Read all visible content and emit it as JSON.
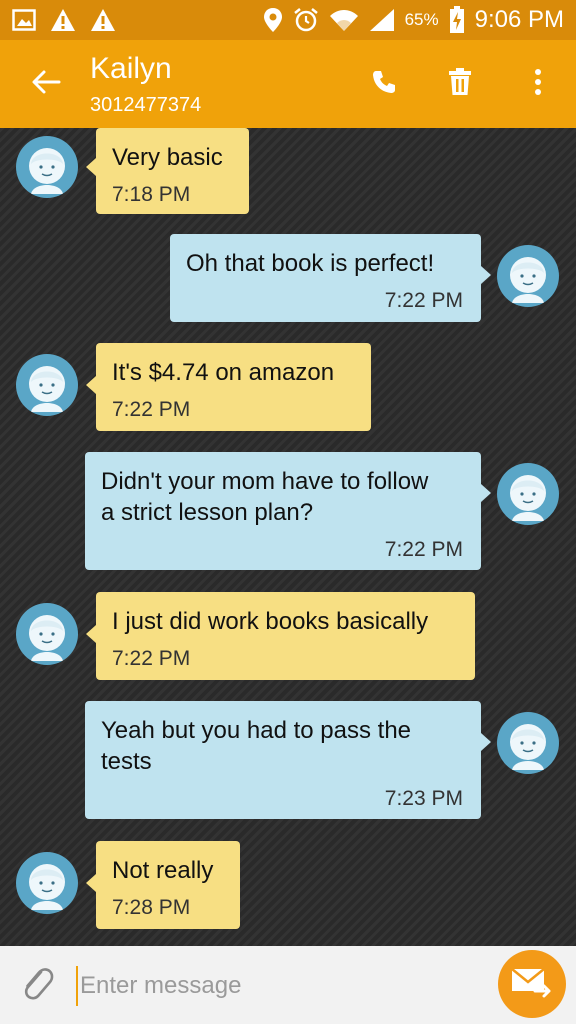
{
  "status_bar": {
    "battery_percent": "65%",
    "time": "9:06 PM",
    "icons": [
      "image-icon",
      "warning-icon",
      "warning-icon",
      "location-icon",
      "alarm-icon",
      "wifi-icon",
      "signal-icon",
      "battery-charging-icon"
    ]
  },
  "app_bar": {
    "title": "Kailyn",
    "subtitle": "3012477374",
    "actions": [
      "call-icon",
      "delete-icon",
      "more-icon"
    ]
  },
  "messages": [
    {
      "direction": "in",
      "lines": [
        "Very basic"
      ],
      "time": "7:18 PM"
    },
    {
      "direction": "out",
      "lines": [
        "Oh that book is perfect!"
      ],
      "time": "7:22 PM"
    },
    {
      "direction": "in",
      "lines": [
        "It's $4.74 on amazon"
      ],
      "time": "7:22 PM"
    },
    {
      "direction": "out",
      "lines": [
        "Didn't your mom have to follow",
        "a strict lesson plan?"
      ],
      "time": "7:22 PM"
    },
    {
      "direction": "in",
      "lines": [
        "I just did work books basically"
      ],
      "time": "7:22 PM"
    },
    {
      "direction": "out",
      "lines": [
        "Yeah but you had to pass the",
        "tests"
      ],
      "time": "7:23 PM"
    },
    {
      "direction": "in",
      "lines": [
        "Not really"
      ],
      "time": "7:28 PM"
    }
  ],
  "composer": {
    "placeholder": "Enter message",
    "value": ""
  },
  "colors": {
    "status_bar": "#d98b0a",
    "app_bar": "#f0a20a",
    "incoming_bubble": "#f7df83",
    "outgoing_bubble": "#bfe3ef",
    "avatar": "#5aa6c7",
    "send_button": "#f39a18"
  }
}
